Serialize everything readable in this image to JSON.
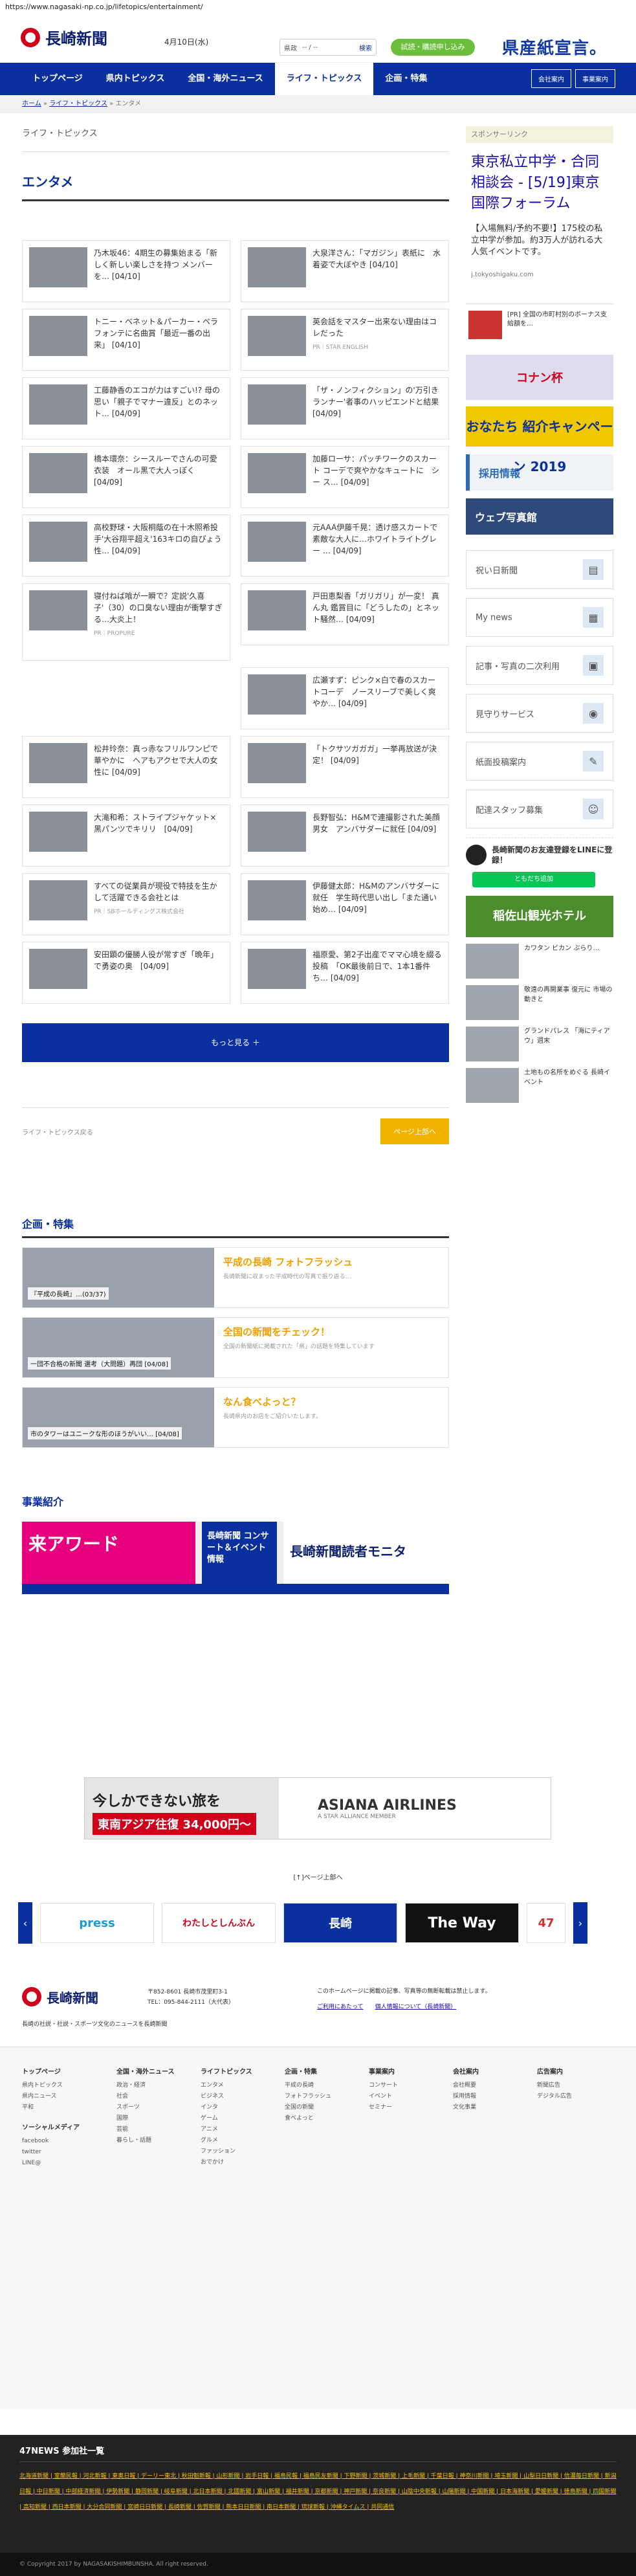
{
  "browser": {
    "url": "https://www.nagasaki-np.co.jp/lifetopics/entertainment/"
  },
  "header": {
    "logo": "長崎新聞",
    "date": "4月10日(水)",
    "search": {
      "scope": "県政",
      "select": "-- / --",
      "button": "検索"
    },
    "trial_button": "試読・購読申し込み",
    "ad_brand": "県産紙宣言。"
  },
  "nav": {
    "items": [
      "トップページ",
      "県内トピックス",
      "全国・海外ニュース",
      "ライフ・トピックス",
      "企画・特集"
    ],
    "right": [
      "会社案内",
      "事業案内"
    ]
  },
  "breadcrumb": [
    "ホーム",
    "ライフ・トピックス",
    "エンタメ"
  ],
  "section": {
    "label": "ライフ・トピックス",
    "title": "エンタメ"
  },
  "articles": [
    {
      "text": "乃木坂46：4期生の募集始まる「新しく新しい楽しさを持つ メンバーを… [04/10]"
    },
    {
      "text": "大泉洋さん：「マガジン」表紙に　水着姿で大ぼやき [04/10]"
    },
    {
      "text": "トニー・ベネット＆パーカー・ペラフォンテに名曲賞「最近一番の出来」 [04/10]"
    },
    {
      "text": "英会話をマスター出来ない理由はコレだった",
      "cap": "PR｜STAR ENGLISH"
    },
    {
      "text": "工藤静香のエコが力はすごい!? 母の思い「親子でマナー違反」とのネット… [04/09]"
    },
    {
      "text": "「ザ・ノンフィクション」の'万引き ランナー'者事のハッピエンドと結果 [04/09]"
    },
    {
      "text": "橋本環奈：シースルーでさんの可愛衣装　オール黒で大人っぽく　[04/09]"
    },
    {
      "text": "加藤ローサ：パッチワークのスカート コーデで爽やかなキュートに　シー ス… [04/09]"
    },
    {
      "text": "高校野球・大阪桐蔭の在十木照希投手'大谷翔平超え'163キロの自ぴょう性… [04/09]"
    },
    {
      "text": "元AAA伊藤千晃：透け感スカートで素敵な大人に…ホワイトライトグレー … [04/09]"
    },
    {
      "text": "寝付ねば喰が一瞬で？定説'久喜子'（30）の口臭ない理由が衝撃すぎる…大炎上！",
      "cap": "PR｜PROPURE"
    },
    {
      "text": "戸田恵梨香「ガリガリ」が一変！ 真ん丸 鑑賞目に「どうしたの」とネット騒然… [04/09]"
    },
    {
      "text": "広瀬すず：ピンク×白で春のスカートコーデ　ノースリーブで美しく爽やか… [04/09]"
    },
    {
      "text": "松井玲奈：真っ赤なフリルワンピで華やかに　ヘアもアクセで大人の女性に [04/09]"
    },
    {
      "text": "「トクサツガガガ」一挙再放送が決定！ [04/09]"
    },
    {
      "text": "大滝和希：ストライプジャケット×黒パンツでキリリ　[04/09]"
    },
    {
      "text": "長野智弘：H&Mで連撮影された美顔男女　アンバサダーに就任 [04/09]"
    },
    {
      "text": "すべての従業員が現役で特技を生かして活躍できる会社とは",
      "cap": "PR｜SBホールディングス株式会社"
    },
    {
      "text": "伊藤健太郎：H&Mのアンバサダーに就任　学生時代思い出し「また通い始め… [04/09]"
    },
    {
      "text": "安田顕の優勝人役が常すぎ「晩年」で勇姿の奥　[04/09]"
    },
    {
      "text": "福原愛、第2子出産でママ心境を綴る投稿　「OK最後前日で、1本1番件ち… [04/09]"
    }
  ],
  "more_button": "もっと見る ＋",
  "pager": {
    "back": "ライフ・トピックス戻る",
    "top": "ページ上部へ"
  },
  "features": {
    "title": "企画・特集",
    "items": [
      {
        "label": "平成の長崎 フォトフラッシュ",
        "sub": "長崎新聞に収まった平成時代の写真で振り返る…",
        "img": "『平成の長崎』…(03/37)"
      },
      {
        "label": "全国の新聞をチェック！",
        "sub": "全国の新聞紙に掲載された「県」の話題を特集しています",
        "img": "一団不合格の新聞 選考（大問題）再団 [04/08]"
      },
      {
        "label": "なん食べよっと？",
        "sub": "長崎県内のお店をご紹介いたします。",
        "img": "市のタワーはユニークな形のほうがいい… [04/08]"
      }
    ]
  },
  "business": {
    "title": "事業紹介",
    "banners": [
      "来アワード",
      "長崎新聞 コンサート＆イベント情報",
      "長崎新聞読者モニタ"
    ]
  },
  "sidebar": {
    "sponsor": "スポンサーリンク",
    "ad": {
      "title": "東京私立中学・合同相談会 - [5/19]東京国際フォーラム",
      "body": "【入場無料/予約不要!】175校の私立中学が参加。約3万人が訪れる大人気イベントです。",
      "domain": "j.tokyoshigaku.com"
    },
    "news": "[PR] 全国の市町村別のボーナス支給額を…",
    "ban1": "コナン杯",
    "ban2": "おなたち 紹介キャンペーン 2019",
    "recruit": "採用情報",
    "photo": "ウェブ写真館",
    "links": [
      "祝い日新聞",
      "My news",
      "記事・写真の二次利用",
      "見守りサービス",
      "紙面投稿案内",
      "配達スタッフ募集"
    ],
    "line": {
      "title": "長崎新聞のお友達登録をLINEに登録！",
      "button": "ともだち追加"
    },
    "hotel": "稲佐山観光ホテル",
    "side_items": [
      "カワタン ビカン ぶらり…",
      "敬遠の再開業事 復元に 市場の動きと",
      "グランドパレス 「海にティアウ」週末",
      "土地もの名所をめぐる  長崎イベント"
    ]
  },
  "bottom_ad": {
    "title": "今しかできない旅を",
    "price": "東南アジア往復 34,000円～",
    "brand": "ASIANA AIRLINES",
    "alliance": "A STAR ALLIANCE MEMBER"
  },
  "ad_link": "[↑]ページ上部へ",
  "carousel": [
    "press",
    "わたしとしんぶん",
    "長崎",
    "The Way",
    "47"
  ],
  "footer": {
    "address": "〒852-8601 長崎市茂里町3-1",
    "tel": "TEL：095-844-2111（大代表）",
    "sub": "長崎の社説・社説・スポーツ文化のニュースを長崎新聞",
    "note": "このホームページに掲載の記事、写真等の無断転載は禁止します。",
    "links": [
      "ご利用にあたって",
      "個人情報について（長崎新聞）"
    ],
    "cols": [
      {
        "hd": "トップページ",
        "items": [
          "県内トピックス",
          "県内ニュース",
          "平和",
          "ソーシャルメディア",
          "facebook",
          "twitter",
          "LINE@"
        ]
      },
      {
        "hd": "全国・海外ニュース",
        "items": [
          "政治・経済",
          "社会",
          "スポーツ",
          "国際",
          "芸能",
          "暮らし・話題"
        ]
      },
      {
        "hd": "ライフトピックス",
        "items": [
          "エンタメ",
          "ビジネス",
          "インタ",
          "ゲーム",
          "アニメ",
          "グルメ",
          "ファッション",
          "おでかけ"
        ]
      },
      {
        "hd": "企画・特集",
        "items": [
          "平成の長崎",
          "フォトフラッシュ",
          "全国の新聞",
          "食べよっと"
        ]
      },
      {
        "hd": "事業案内",
        "items": [
          "コンサート",
          "イベント",
          "セミナー"
        ]
      },
      {
        "hd": "会社案内",
        "items": [
          "会社概要",
          "採用情報",
          "文化事業"
        ]
      },
      {
        "hd": "広告案内",
        "items": [
          "新聞広告",
          "デジタル広告"
        ]
      }
    ]
  },
  "n47": {
    "title": "47NEWS 参加社一覧",
    "list": "北海道新聞 | 室蘭民報 | 河北新報 | 東奥日報 | デーリー東北 | 秋田魁新報 | 山形新聞 | 岩手日報 | 福島民報 | 福島民友新聞 | 下野新聞 | 茨城新聞 | 上毛新聞 | 千葉日報 | 神奈川新聞 | 埼玉新聞 | 山梨日日新聞 | 信濃毎日新聞 | 新潟日報 | 中日新聞 | 中部経済新聞 | 伊勢新聞 | 静岡新聞 | 岐阜新聞 | 北日本新聞 | 北國新聞 | 富山新聞 | 福井新聞 | 京都新聞 | 神戸新聞 | 奈良新聞 | 山陰中央新報 | 山陽新聞 | 中国新聞 | 日本海新聞 | 愛媛新聞 | 徳島新聞 | 四国新聞 | 高知新聞 | 西日本新聞 | 大分合同新聞 | 宮崎日日新聞 | 長崎新聞 | 佐賀新聞 | 熊本日日新聞 | 南日本新聞 | 琉球新報 | 沖縄タイムス | 共同通信"
  },
  "copyright": "© Copyright 2017 by NAGASAKISHIMBUNSHA. All right reserved."
}
